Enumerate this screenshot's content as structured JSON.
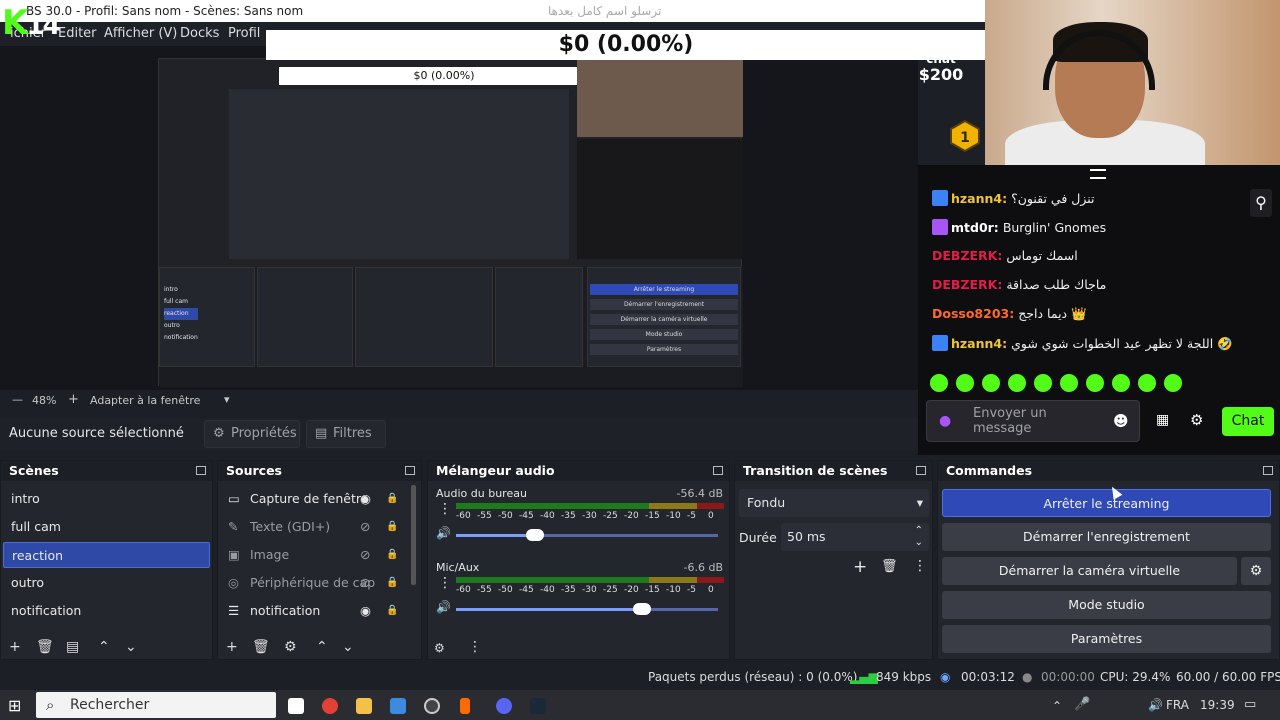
{
  "window": {
    "title": "OBS 30.0.2 - Profil: Sans nom - Scènes: Sans nom",
    "title_visible": "BS 30.0 - Profil: Sans nom - Scènes: Sans nom",
    "logo_letter": "K",
    "logo_num": "14"
  },
  "menu": {
    "items": [
      "Fichier",
      "Éditer",
      "Afficher (V)",
      "Docks",
      "Profil"
    ],
    "visible": [
      "ichier",
      "Editer",
      "Afficher (V)",
      "Docks",
      "Profil"
    ]
  },
  "overlay": {
    "banner": "$0 (0.00%)",
    "dollar": "$200",
    "chat_label": "chat",
    "arabic_top": "ترسلو اسم كامل بعدها"
  },
  "nested": {
    "banner": "$0 (0.00%)",
    "commands": [
      "Arrêter le streaming",
      "Démarrer l'enregistrement",
      "Démarrer la caméra virtuelle",
      "Mode studio",
      "Paramètres"
    ],
    "scenes": [
      "intro",
      "full cam",
      "reaction",
      "outro",
      "notification"
    ]
  },
  "chat": {
    "messages": [
      {
        "user": "hzann4:",
        "text": "تنزل في تقنون؟",
        "color": "#f0c43f",
        "badge": "#3b82f6"
      },
      {
        "user": "mtd0r:",
        "text": "Burglin' Gnomes",
        "color": "#ffffff",
        "badge": "#a855f7"
      },
      {
        "user": "DEBZERK:",
        "text": "اسمك توماس",
        "color": "#e11d48",
        "badge": ""
      },
      {
        "user": "DEBZERK:",
        "text": "ماجاك طلب صداقة",
        "color": "#e11d48",
        "badge": ""
      },
      {
        "user": "Dosso8203:",
        "text": "ديما داجج 👑",
        "color": "#ff6a2b",
        "badge": ""
      },
      {
        "user": "hzann4:",
        "text": "اللجة لا تظهر عيد الخطوات شوي شوي 🤣",
        "color": "#f0c43f",
        "badge": "#3b82f6"
      }
    ],
    "input_placeholder": "Envoyer un message",
    "send_label": "Chat",
    "badge_num": "1"
  },
  "preview": {
    "zoom": "48%",
    "fit_label": "Adapter à la fenêtre"
  },
  "context": {
    "no_source": "Aucune source sélectionné",
    "properties": "Propriétés",
    "filters": "Filtres"
  },
  "scenes": {
    "title": "Scènes",
    "items": [
      "intro",
      "full cam",
      "reaction",
      "outro",
      "notification"
    ],
    "selected": 2
  },
  "sources": {
    "title": "Sources",
    "items": [
      "Capture de fenêtre",
      "Texte (GDI+)",
      "Image",
      "Périphérique de cap",
      "notification"
    ]
  },
  "mixer": {
    "title": "Mélangeur audio",
    "channels": [
      {
        "name": "Audio du bureau",
        "db": "-56.4 dB",
        "volume": 0.3
      },
      {
        "name": "Mic/Aux",
        "db": "-6.6 dB",
        "volume": 0.71
      }
    ],
    "scale": [
      "-60",
      "-55",
      "-50",
      "-45",
      "-40",
      "-35",
      "-30",
      "-25",
      "-20",
      "-15",
      "-10",
      "-5",
      "0"
    ]
  },
  "transition": {
    "title": "Transition de scènes",
    "selected": "Fondu",
    "duration_label": "Durée",
    "duration": "50 ms"
  },
  "commands": {
    "title": "Commandes",
    "buttons": [
      "Arrêter le streaming",
      "Démarrer l'enregistrement",
      "Démarrer la caméra virtuelle",
      "Mode studio",
      "Paramètres"
    ]
  },
  "status": {
    "dropped": "Paquets perdus (réseau) : 0 (0.0%)",
    "kbps": "849 kbps",
    "stream_time": "00:03:12",
    "rec_time": "00:00:00",
    "cpu": "CPU: 29.4%",
    "fps": "60.00 / 60.00 FPS"
  },
  "taskbar": {
    "search": "Rechercher",
    "lang": "FRA",
    "time": "19:39"
  }
}
